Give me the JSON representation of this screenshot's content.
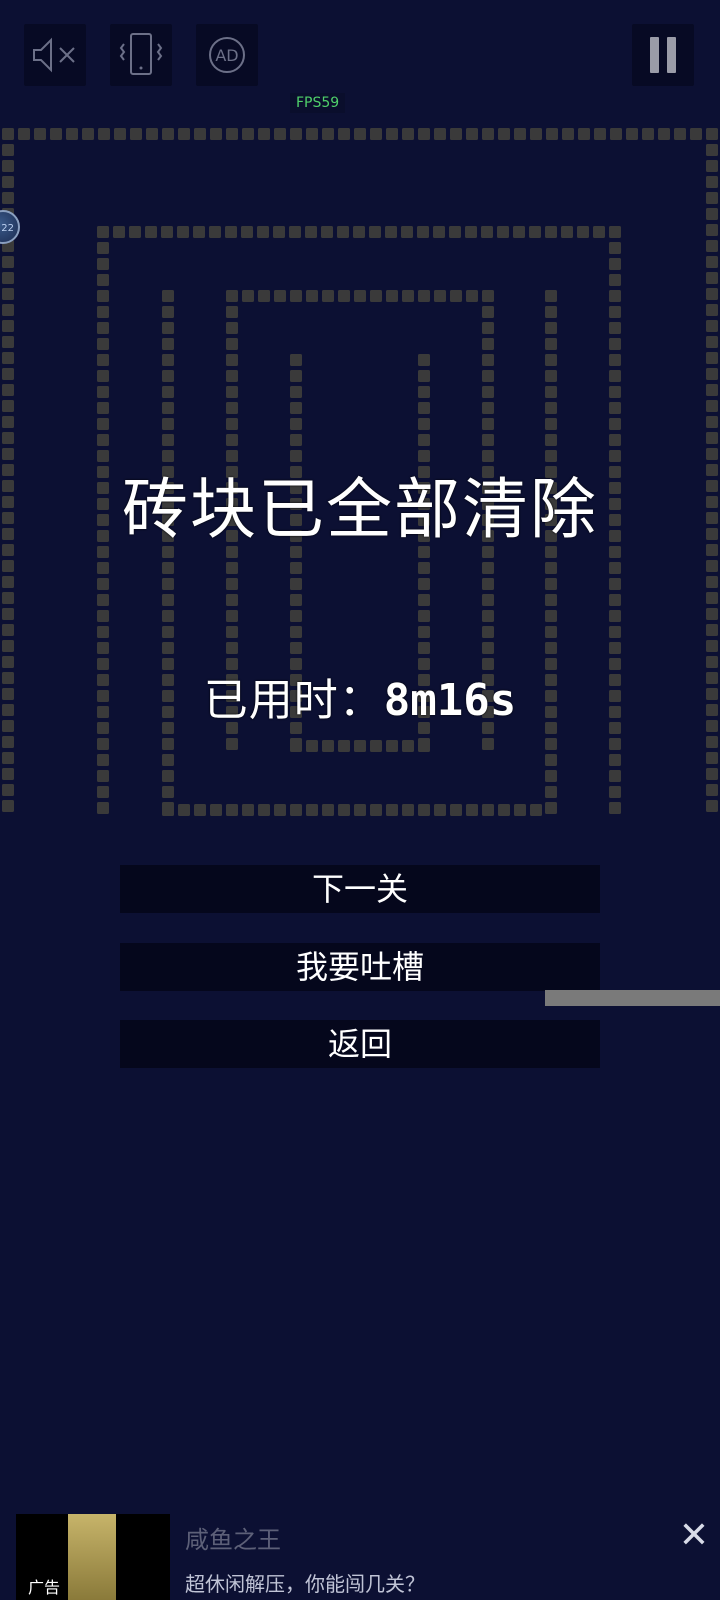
{
  "hud": {
    "fps_label": "FPS59",
    "icons": {
      "mute": "speaker-muted-icon",
      "vibrate": "phone-vibrate-icon",
      "ad": "ad-icon",
      "pause": "pause-icon"
    },
    "ad_icon_text": "AD",
    "ball_text": "22"
  },
  "result": {
    "title": "砖块已全部清除",
    "time_label": "已用时：",
    "time_value": "8m16s"
  },
  "menu": {
    "next_level": "下一关",
    "feedback": "我要吐槽",
    "back": "返回"
  },
  "ad_banner": {
    "badge": "广告",
    "title": "咸鱼之王",
    "description": "超休闲解压，你能闯几关？",
    "close_icon": "close-icon"
  },
  "colors": {
    "background": "#0c1033",
    "brick": "#3a3a3a",
    "button_bg": "#05071c",
    "fps_text": "#4fd06a"
  }
}
